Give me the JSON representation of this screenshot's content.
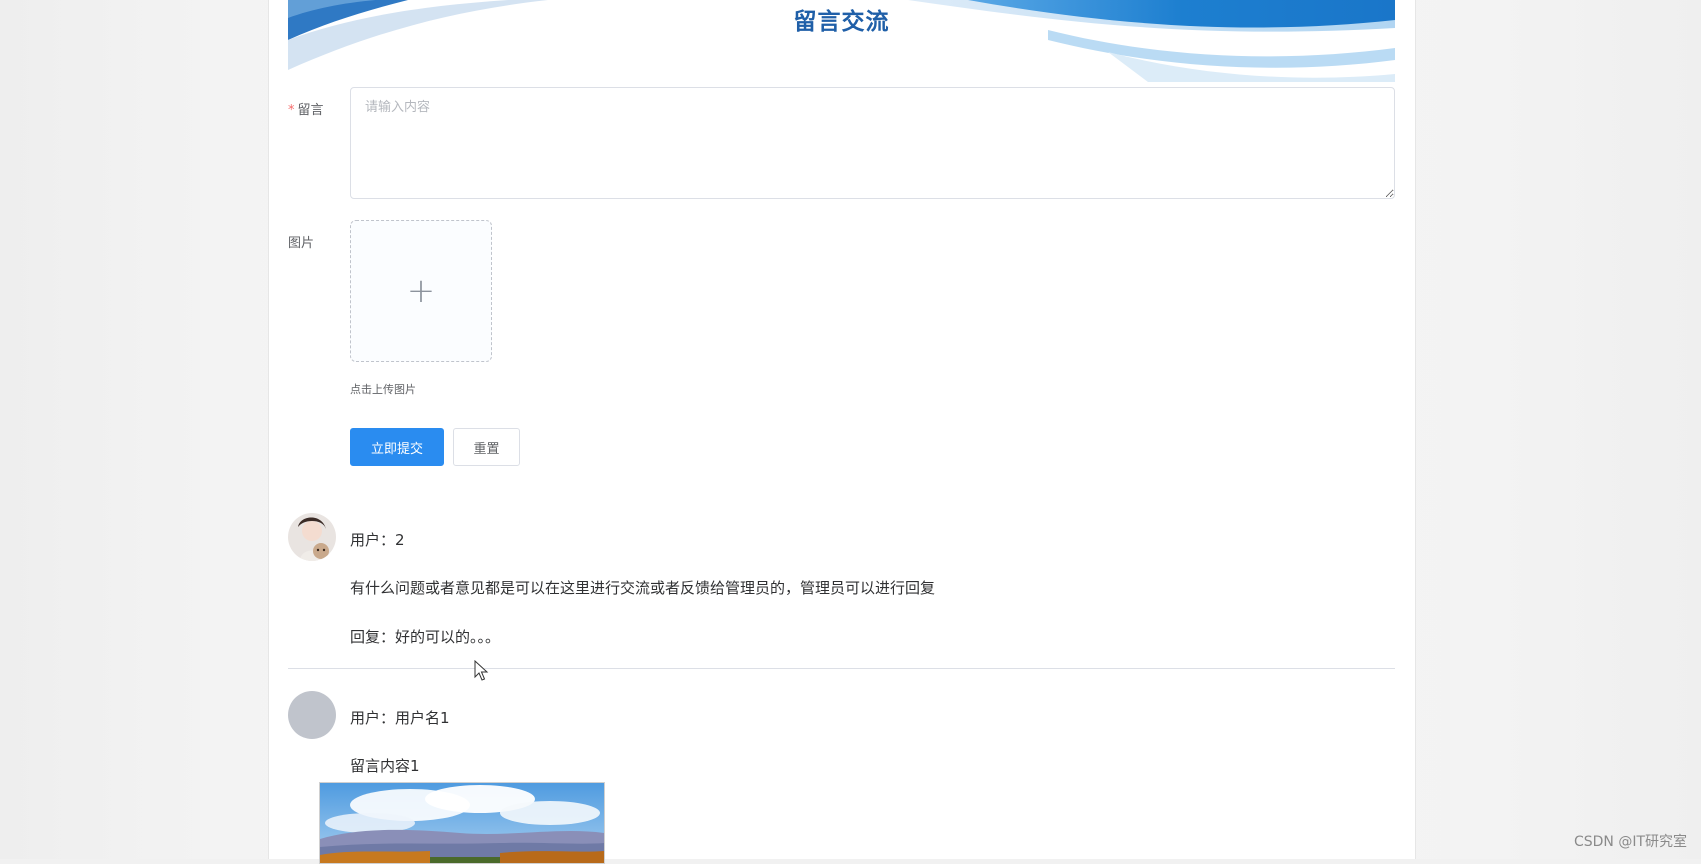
{
  "banner": {
    "title": "留言交流"
  },
  "form": {
    "message_label": "留言",
    "required_mark": "*",
    "message_placeholder": "请输入内容",
    "message_value": "",
    "image_label": "图片",
    "upload_icon": "plus-icon",
    "upload_glyph": "+",
    "upload_tip": "点击上传图片",
    "submit_label": "立即提交",
    "reset_label": "重置"
  },
  "comments": [
    {
      "user": "用户：2",
      "content": "有什么问题或者意见都是可以在这里进行交流或者反馈给管理员的，管理员可以进行回复",
      "reply": "回复：好的可以的。。。"
    },
    {
      "user": "用户：用户名1",
      "content": "留言内容1"
    }
  ],
  "watermark": "CSDN @IT研究室",
  "colors": {
    "primary": "#2a8cf0",
    "banner_title": "#1f5fa8",
    "banner_wave": "#1e88d6",
    "required": "#f56c6c"
  }
}
